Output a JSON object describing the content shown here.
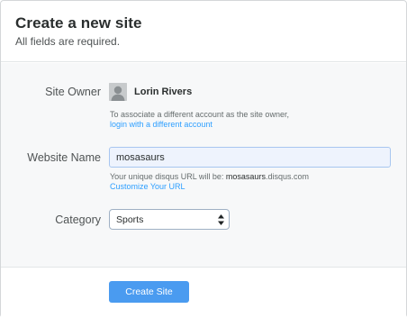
{
  "header": {
    "title": "Create a new site",
    "subtitle": "All fields are required."
  },
  "owner": {
    "label": "Site Owner",
    "name": "Lorin Rivers",
    "avatar_icon": "user-silhouette-icon",
    "help_text": "To associate a different account as the site owner,",
    "link_text": "login with a different account"
  },
  "website": {
    "label": "Website Name",
    "value": "mosasaurs",
    "help_prefix": "Your unique disqus URL will be: ",
    "help_url_strong": "mosasaurs",
    "help_url_suffix": ".disqus.com",
    "link_text": "Customize Your URL"
  },
  "category": {
    "label": "Category",
    "selected": "Sports",
    "arrow_icon": "select-arrows-icon"
  },
  "footer": {
    "submit_label": "Create Site"
  },
  "colors": {
    "accent": "#4a9bf0",
    "link": "#2e9fff",
    "input_bg": "#eef3fd"
  }
}
